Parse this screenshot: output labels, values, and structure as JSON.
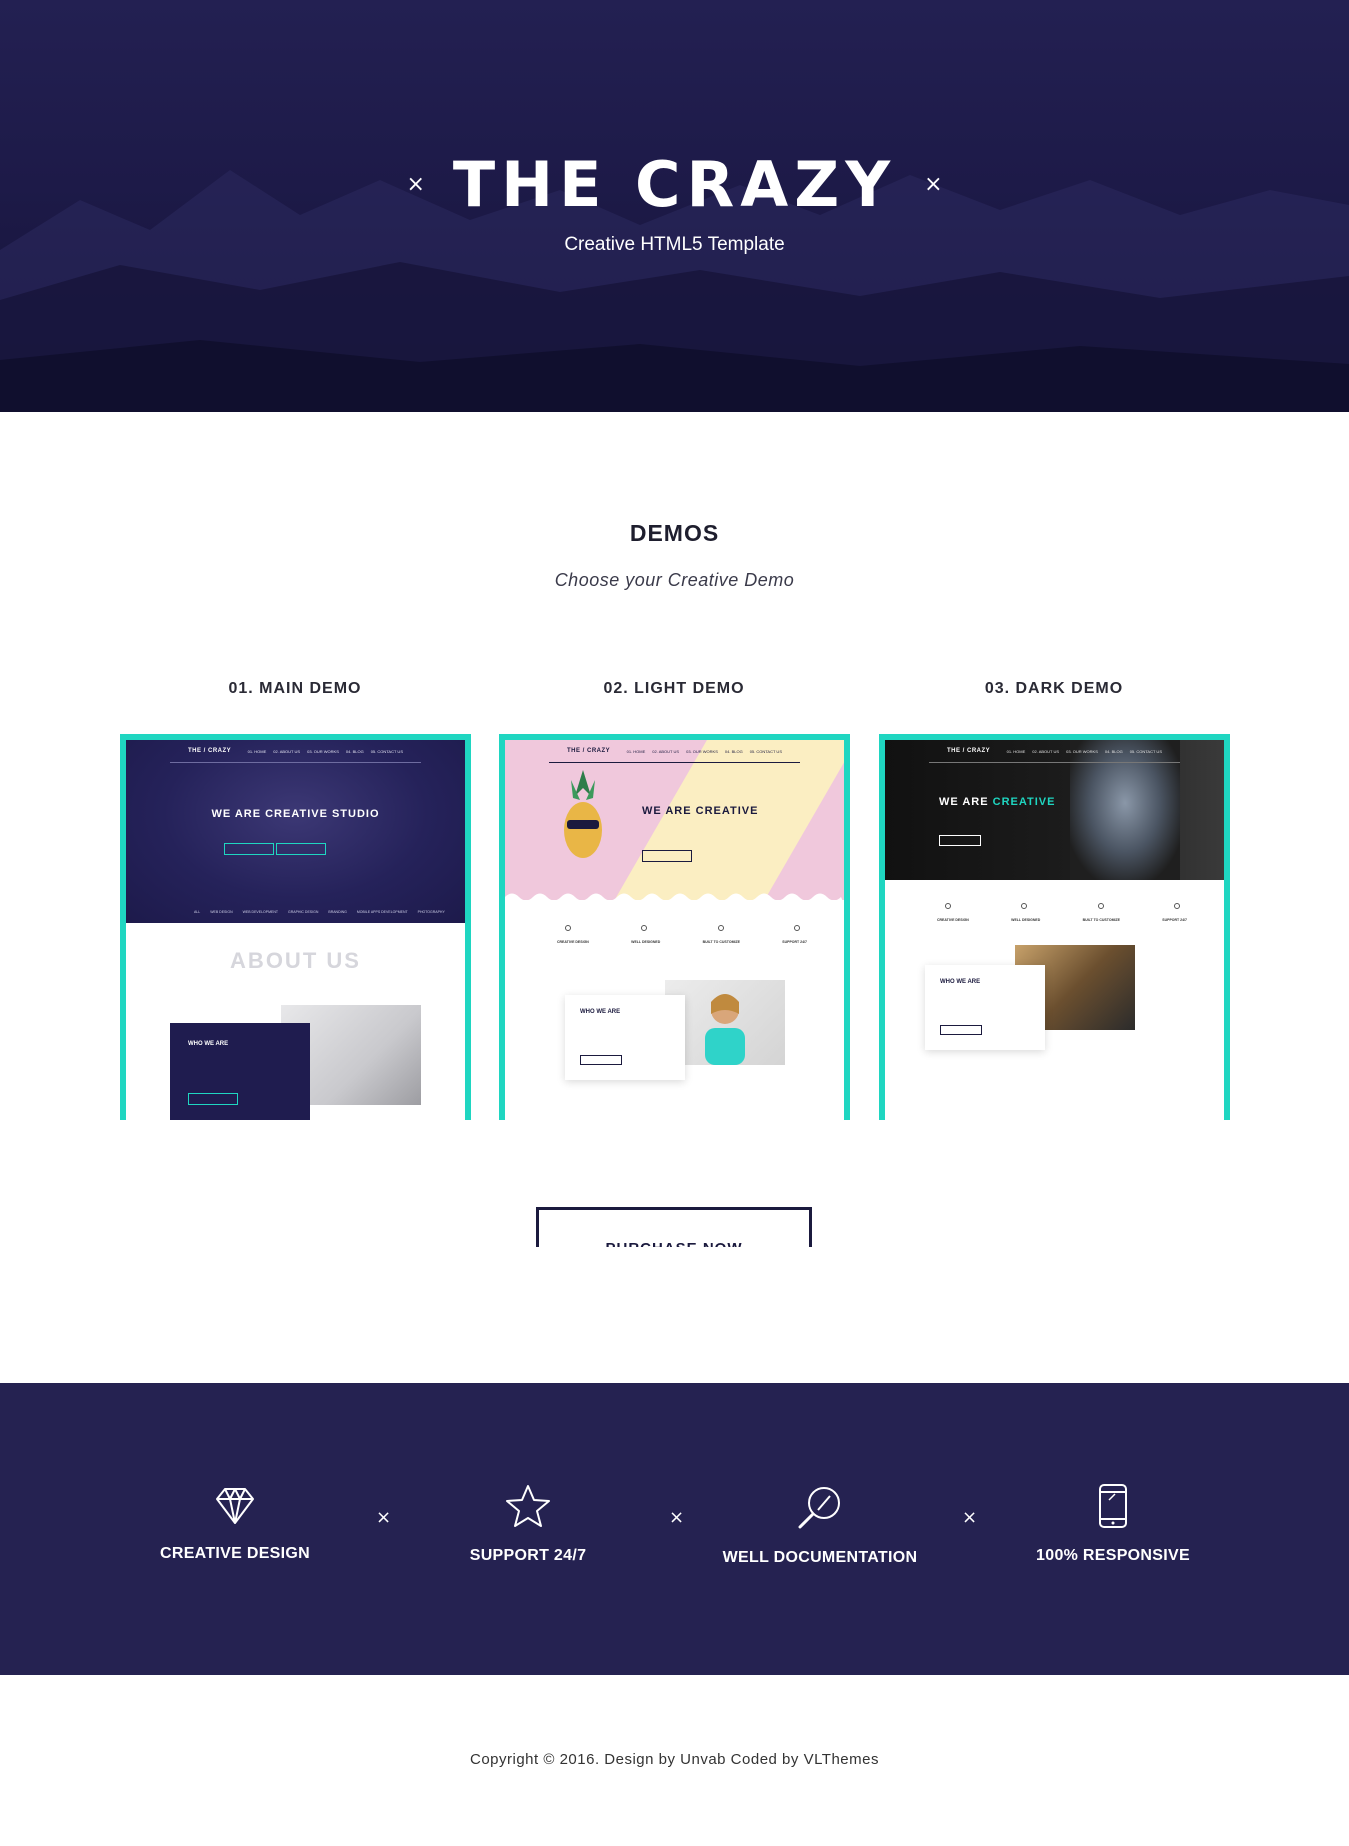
{
  "hero": {
    "title": "THE CRAZY",
    "subtitle": "Creative HTML5 Template",
    "decor_left": "×",
    "decor_right": "×"
  },
  "demos": {
    "title": "DEMOS",
    "subtitle": "Choose your Creative Demo",
    "items": [
      {
        "label": "01. MAIN DEMO",
        "preview": {
          "logo": "THE / CRAZY",
          "nav": [
            "01. HOME",
            "02. ABOUT US",
            "03. OUR WORKS",
            "04. BLOG",
            "05. CONTACT US"
          ],
          "headline": "WE ARE CREATIVE STUDIO",
          "filters": [
            "ALL",
            "WEB DESIGN",
            "WEB DEVELOPMENT",
            "GRAPHIC DESIGN",
            "BRANDING",
            "MOBILE APPS DEVELOPMENT",
            "PHOTOGRAPHY"
          ],
          "section_title": "ABOUT US",
          "box_title": "WHO WE ARE"
        }
      },
      {
        "label": "02. LIGHT DEMO",
        "preview": {
          "logo": "THE / CRAZY",
          "nav": [
            "01. HOME",
            "02. ABOUT US",
            "03. OUR WORKS",
            "04. BLOG",
            "05. CONTACT US"
          ],
          "headline": "WE ARE CREATIVE",
          "features": [
            "CREATIVE DESIGN",
            "WELL DESIGNED",
            "BUILT TO CUSTOMIZE",
            "SUPPORT 24/7"
          ],
          "box_title": "WHO WE ARE"
        }
      },
      {
        "label": "03. DARK DEMO",
        "preview": {
          "logo": "THE / CRAZY",
          "nav": [
            "01. HOME",
            "02. ABOUT US",
            "03. OUR WORKS",
            "04. BLOG",
            "05. CONTACT US"
          ],
          "headline_prefix": "WE ARE",
          "headline_accent": "CREATIVE",
          "features": [
            "CREATIVE DESIGN",
            "WELL DESIGNED",
            "BUILT TO CUSTOMIZE",
            "SUPPORT 24/7"
          ],
          "box_title": "WHO WE ARE"
        }
      }
    ]
  },
  "purchase": {
    "label": "PURCHASE NOW"
  },
  "features": [
    {
      "icon": "diamond-icon",
      "label": "CREATIVE DESIGN"
    },
    {
      "icon": "star-icon",
      "label": "SUPPORT 24/7"
    },
    {
      "icon": "magnifier-icon",
      "label": "WELL DOCUMENTATION"
    },
    {
      "icon": "smartphone-icon",
      "label": "100% RESPONSIVE"
    }
  ],
  "features_separator": "×",
  "footer": {
    "copyright": "Copyright © 2016. Design by Unvab Coded by VLThemes"
  },
  "colors": {
    "navy": "#1b1a3e",
    "hero_bg": "#1d1a48",
    "features_bg": "#252251",
    "accent": "#1fd6c1",
    "pink": "#f0c8dc",
    "cream": "#fbeec2"
  }
}
